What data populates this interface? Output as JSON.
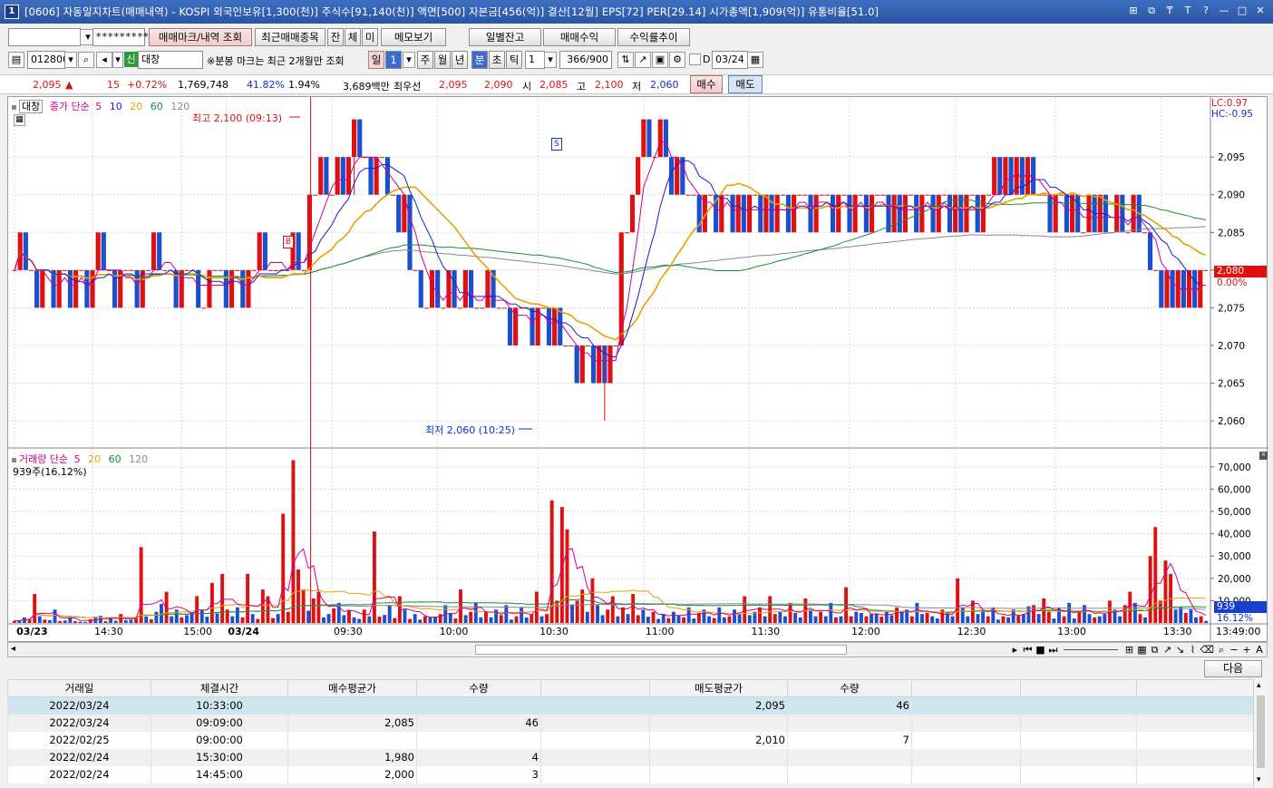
{
  "window": {
    "number": "1",
    "title": "[0606] 자동일지차트(매매내역) - KOSPI 외국인보유[1,300(천)] 주식수[91,140(천)] 액면[500] 자본금[456(억)] 결산[12월] EPS[72] PER[29.14] 시가총액[1,909(억)] 유통비율[51.0]",
    "controls": [
      "⊞",
      "⧉",
      "₸",
      "T",
      "?",
      "—",
      "□",
      "✕"
    ]
  },
  "toolbar1": {
    "account_value": "",
    "password_mask": "*********",
    "buttons": [
      "매매마크/내역 조회",
      "최근매매종목",
      "잔",
      "체",
      "미",
      "메모보기",
      "일별잔고",
      "매매수익",
      "수익률추이"
    ]
  },
  "toolbar2": {
    "code": "012800",
    "name_badge": "신",
    "name": "대창",
    "notice": "※분봉 마크는 최근 2개월만 조회",
    "periods": [
      "일",
      "1",
      "주",
      "월",
      "년",
      "분",
      "초",
      "틱"
    ],
    "interval": "1",
    "count": "366/900",
    "date": "03/24",
    "d_label": "D"
  },
  "quote": {
    "price": "2,095",
    "change_arrow": "▲",
    "change": "15",
    "change_pct": "+0.72%",
    "volume": "1,769,748",
    "vol_ratio": "41.82%",
    "turnover_pct": "1.94%",
    "amount": "3,689백만",
    "best_label": "최우선",
    "best_ask": "2,095",
    "best_bid": "2,090",
    "open_label": "시",
    "open": "2,085",
    "high_label": "고",
    "high": "2,100",
    "low_label": "저",
    "low": "2,060",
    "buy_btn": "매수",
    "sell_btn": "매도"
  },
  "price_panel": {
    "name_label": "대창",
    "legend_prefix": "종가 단순",
    "ma_periods": [
      "5",
      "10",
      "20",
      "60",
      "120"
    ],
    "ma_colors": [
      "#d0008c",
      "#1a1ad0",
      "#e8a000",
      "#1a8c3a",
      "#888888"
    ],
    "lc": "LC:0.97",
    "hc": "HC:-0.95",
    "high_annotation": "최고 2,100 (09:13)",
    "low_annotation": "최저 2,060 (10:25)",
    "current_price_tag": "2,080",
    "current_pct_tag": "0.00%",
    "buy_marker": "B",
    "sell_marker": "S"
  },
  "volume_panel": {
    "legend_prefix": "거래량 단순",
    "ma_periods": [
      "5",
      "20",
      "60",
      "120"
    ],
    "ma_colors": [
      "#d0008c",
      "#e8a000",
      "#1a8c3a",
      "#888888"
    ],
    "summary": "939주(16.12%)",
    "current_tag": "939",
    "current_pct_tag": "16.12%"
  },
  "chart_data": [
    {
      "type": "candlestick",
      "title": "",
      "y_ticks": [
        2060,
        2065,
        2070,
        2075,
        2080,
        2085,
        2090,
        2095
      ],
      "ylim": [
        2057,
        2102
      ],
      "high": 2100,
      "high_time": "09:13",
      "low": 2060,
      "low_time": "10:25",
      "x_labels": [
        "03/23",
        "14:30",
        "15:00",
        "03/24",
        "09:30",
        "10:00",
        "10:30",
        "11:00",
        "11:30",
        "12:00",
        "12:30",
        "13:00",
        "13:30",
        "13:49:00"
      ],
      "closes": [
        2080,
        2085,
        2080,
        2080,
        2075,
        2080,
        2080,
        2075,
        2080,
        2080,
        2075,
        2080,
        2080,
        2075,
        2080,
        2085,
        2080,
        2080,
        2075,
        2080,
        2080,
        2080,
        2075,
        2080,
        2080,
        2085,
        2080,
        2080,
        2080,
        2075,
        2080,
        2080,
        2080,
        2075,
        2075,
        2080,
        2080,
        2080,
        2075,
        2080,
        2080,
        2075,
        2080,
        2080,
        2085,
        2080,
        2080,
        2080,
        2080,
        2080,
        2085,
        2080,
        2080,
        2090,
        2090,
        2095,
        2090,
        2090,
        2095,
        2090,
        2095,
        2100,
        2095,
        2095,
        2090,
        2095,
        2095,
        2090,
        2090,
        2085,
        2090,
        2080,
        2080,
        2075,
        2075,
        2080,
        2075,
        2075,
        2080,
        2075,
        2075,
        2080,
        2075,
        2075,
        2075,
        2080,
        2075,
        2075,
        2075,
        2070,
        2075,
        2075,
        2075,
        2070,
        2075,
        2075,
        2070,
        2075,
        2070,
        2070,
        2070,
        2065,
        2070,
        2070,
        2065,
        2070,
        2065,
        2070,
        2070,
        2085,
        2085,
        2090,
        2095,
        2100,
        2095,
        2095,
        2100,
        2095,
        2090,
        2095,
        2090,
        2090,
        2090,
        2085,
        2090,
        2090,
        2085,
        2090,
        2090,
        2085,
        2090,
        2085,
        2090,
        2090,
        2085,
        2090,
        2085,
        2090,
        2090,
        2085,
        2090,
        2090,
        2090,
        2085,
        2090,
        2090,
        2090,
        2085,
        2090,
        2090,
        2085,
        2090,
        2090,
        2085,
        2090,
        2090,
        2090,
        2085,
        2090,
        2085,
        2090,
        2090,
        2085,
        2090,
        2090,
        2085,
        2090,
        2090,
        2085,
        2090,
        2085,
        2090,
        2090,
        2085,
        2090,
        2090,
        2095,
        2090,
        2095,
        2090,
        2095,
        2090,
        2095,
        2090,
        2090,
        2090,
        2085,
        2090,
        2090,
        2085,
        2090,
        2085,
        2085,
        2090,
        2085,
        2090,
        2085,
        2085,
        2090,
        2085,
        2085,
        2090,
        2085,
        2085,
        2080,
        2080,
        2075,
        2080,
        2075,
        2080,
        2075,
        2080,
        2075,
        2080,
        2080
      ]
    },
    {
      "type": "bar",
      "title": "",
      "y_ticks": [
        10000,
        20000,
        30000,
        40000,
        50000,
        60000,
        70000
      ],
      "ylim": [
        0,
        74000
      ],
      "values": [
        900,
        1200,
        2500,
        1800,
        13000,
        3000,
        1500,
        1200,
        6000,
        900,
        1100,
        2400,
        800,
        600,
        500,
        1600,
        2800,
        3200,
        800,
        2200,
        1000,
        4000,
        1200,
        1500,
        2000,
        34000,
        3000,
        1600,
        5000,
        8500,
        14000,
        3000,
        6000,
        2500,
        3500,
        4800,
        12000,
        6000,
        2800,
        18000,
        4200,
        22000,
        6000,
        3000,
        7000,
        2500,
        22000,
        4000,
        1800,
        15000,
        12000,
        2200,
        4000,
        49000,
        5000,
        73000,
        24000,
        15000,
        5500,
        11000,
        14000,
        2500,
        4000,
        6500,
        9000,
        3500,
        5500,
        2500,
        1800,
        6000,
        3000,
        41000,
        2800,
        3600,
        8000,
        2200,
        12000,
        6000,
        1800,
        4000,
        1500,
        3000,
        2500,
        2500,
        4000,
        8000,
        4500,
        2000,
        15000,
        3500,
        5000,
        9000,
        2500,
        5000,
        2500,
        6000,
        3500,
        8000,
        1500,
        3000,
        7000,
        2500,
        4000,
        14000,
        3000,
        4000,
        55000,
        10000,
        52000,
        42000,
        8000,
        10000,
        15000,
        5000,
        20000,
        8000,
        3500,
        6000,
        12000,
        3000,
        7000,
        4000,
        13000,
        3500,
        6000,
        2800,
        5000,
        1800,
        4000,
        2200,
        5000,
        3500,
        2500,
        7000,
        2000,
        4500,
        6000,
        3000,
        2200,
        7000,
        2500,
        3000,
        6000,
        4000,
        12000,
        3500,
        5000,
        7000,
        3000,
        12000,
        4000,
        5000,
        3000,
        9000,
        4500,
        2500,
        11000,
        6000,
        3000,
        5000,
        3000,
        9000,
        2500,
        3000,
        16000,
        3000,
        5000,
        4500,
        3000,
        4000,
        4000,
        2800,
        5000,
        3500,
        7000,
        5000,
        6000,
        3000,
        9000,
        4000,
        4500,
        3000,
        2000,
        6000,
        4500,
        3000,
        20000,
        7000,
        3000,
        10000,
        4000,
        5000,
        3000,
        7000,
        1500,
        3000,
        2500,
        6000,
        3500,
        4000,
        7500,
        8000,
        4000,
        11000,
        5000,
        2000,
        7000,
        3000,
        9000,
        2000,
        5000,
        8000,
        4000,
        2500,
        3000,
        4000,
        10000,
        6000,
        3000,
        8000,
        14000,
        9000,
        4000,
        2500,
        30000,
        43000,
        10000,
        28000,
        22000,
        6000,
        7000,
        4500,
        6000,
        2500,
        3000,
        939
      ]
    }
  ],
  "table": {
    "next_button": "다음",
    "columns": [
      "거래일",
      "체결시간",
      "매수평균가",
      "수량",
      "",
      "매도평균가",
      "수량",
      "",
      "",
      ""
    ],
    "rows": [
      [
        "2022/03/24",
        "10:33:00",
        "",
        "",
        "",
        "2,095",
        "46",
        "",
        "",
        ""
      ],
      [
        "2022/03/24",
        "09:09:00",
        "2,085",
        "46",
        "",
        "",
        "",
        "",
        "",
        ""
      ],
      [
        "2022/02/25",
        "09:00:00",
        "",
        "",
        "",
        "2,010",
        "7",
        "",
        "",
        ""
      ],
      [
        "2022/02/24",
        "15:30:00",
        "1,980",
        "4",
        "",
        "",
        "",
        "",
        "",
        ""
      ],
      [
        "2022/02/24",
        "14:45:00",
        "2,000",
        "3",
        "",
        "",
        "",
        "",
        "",
        ""
      ]
    ]
  }
}
